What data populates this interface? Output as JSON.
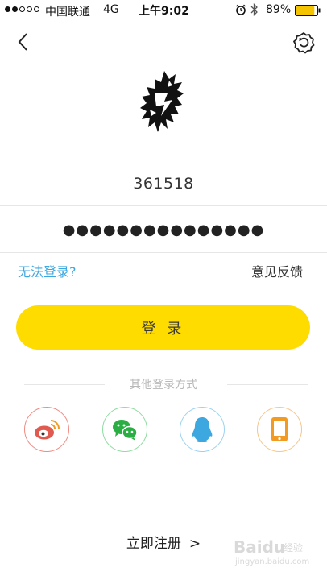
{
  "status_bar": {
    "carrier": "中国联通",
    "network": "4G",
    "time": "上午9:02",
    "battery": "89%",
    "battery_level": 0.89
  },
  "header": {
    "back_icon": "chevron-left-icon",
    "settings_icon": "gear-icon"
  },
  "form": {
    "account": "361518",
    "password": "●●●●●●●●●●●●●●●"
  },
  "links": {
    "help": "无法登录?",
    "feedback": "意见反馈"
  },
  "login_button": "登 录",
  "other_login": {
    "label": "其他登录方式",
    "options": [
      {
        "name": "weibo",
        "icon": "weibo-icon",
        "color": "#e05a50"
      },
      {
        "name": "wechat",
        "icon": "wechat-icon",
        "color": "#2aae43"
      },
      {
        "name": "qq",
        "icon": "qq-icon",
        "color": "#3da7e0"
      },
      {
        "name": "phone",
        "icon": "phone-icon",
        "color": "#f29b24"
      }
    ]
  },
  "register": {
    "label": "立即注册",
    "chevron": ">"
  },
  "watermark": {
    "text": "jingyan.baidu.com"
  },
  "colors": {
    "accent": "#ffdc00",
    "link": "#3da7e0"
  }
}
